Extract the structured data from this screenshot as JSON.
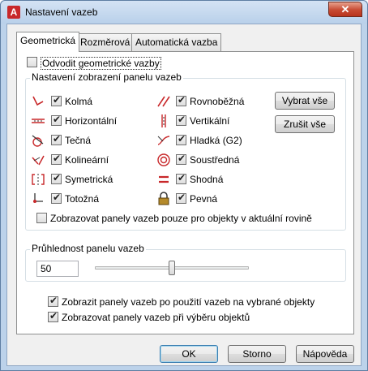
{
  "window": {
    "title": "Nastavení vazeb",
    "close_glyph": "✕",
    "app_icon_letter": "A"
  },
  "tabs": [
    {
      "label": "Geometrická",
      "active": true
    },
    {
      "label": "Rozměrová",
      "active": false
    },
    {
      "label": "Automatická vazba",
      "active": false
    }
  ],
  "infer": {
    "label": "Odvodit geometrické vazby",
    "checked": false
  },
  "display_group": {
    "title": "Nastavení zobrazení panelu vazeb",
    "left": [
      {
        "label": "Kolmá",
        "checked": true,
        "icon": "perpendicular-icon"
      },
      {
        "label": "Horizontální",
        "checked": true,
        "icon": "horizontal-icon"
      },
      {
        "label": "Tečná",
        "checked": true,
        "icon": "tangent-icon"
      },
      {
        "label": "Kolineární",
        "checked": true,
        "icon": "collinear-icon"
      },
      {
        "label": "Symetrická",
        "checked": true,
        "icon": "symmetric-icon"
      },
      {
        "label": "Totožná",
        "checked": true,
        "icon": "coincident-icon"
      }
    ],
    "right": [
      {
        "label": "Rovnoběžná",
        "checked": true,
        "icon": "parallel-icon"
      },
      {
        "label": "Vertikální",
        "checked": true,
        "icon": "vertical-icon"
      },
      {
        "label": "Hladká (G2)",
        "checked": true,
        "icon": "smooth-icon"
      },
      {
        "label": "Soustředná",
        "checked": true,
        "icon": "concentric-icon"
      },
      {
        "label": "Shodná",
        "checked": true,
        "icon": "equal-icon"
      },
      {
        "label": "Pevná",
        "checked": true,
        "icon": "fix-lock-icon"
      }
    ],
    "select_all": "Vybrat vše",
    "clear_all": "Zrušit vše",
    "current_plane": {
      "label": "Zobrazovat panely vazeb pouze pro objekty v aktuální rovině",
      "checked": false
    }
  },
  "transparency": {
    "title": "Průhlednost panelu vazeb",
    "value": "50",
    "slider_value": 50
  },
  "show_after_apply": {
    "label": "Zobrazit panely vazeb po použití vazeb na vybrané objekty",
    "checked": true
  },
  "show_on_select": {
    "label": "Zobrazovat panely vazeb při výběru objektů",
    "checked": true
  },
  "buttons": {
    "ok": "OK",
    "cancel": "Storno",
    "help": "Nápověda"
  },
  "colors": {
    "icon_red": "#c8282a",
    "accent_blue": "#3c7fb1"
  }
}
